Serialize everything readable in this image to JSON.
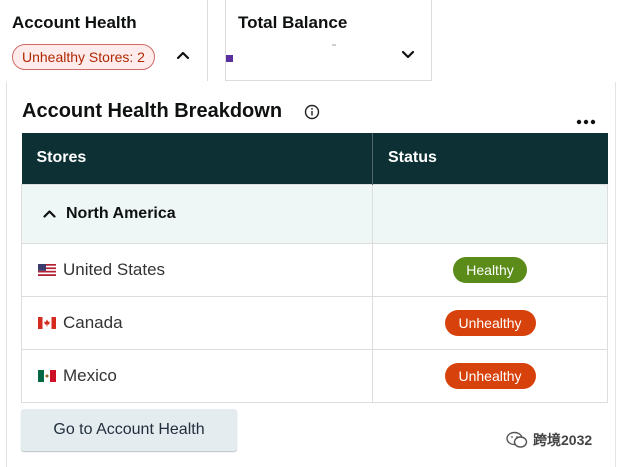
{
  "account_health_card": {
    "title": "Account Health",
    "pill_label": "Unhealthy Stores: 2",
    "chevron_icon": "chevron-up-icon"
  },
  "balance_card": {
    "title": "Total Balance",
    "chevron_icon": "chevron-down-icon"
  },
  "breakdown": {
    "title": "Account Health Breakdown",
    "info_icon": "info-icon",
    "more_icon": "more-options-icon",
    "columns": [
      "Stores",
      "Status"
    ],
    "region": {
      "name": "North America",
      "icon": "chevron-up-icon"
    },
    "rows": [
      {
        "country": "United States",
        "flag": "us-flag-icon",
        "status": "Healthy"
      },
      {
        "country": "Canada",
        "flag": "canada-flag-icon",
        "status": "Unhealthy"
      },
      {
        "country": "Mexico",
        "flag": "mexico-flag-icon",
        "status": "Unhealthy"
      }
    ]
  },
  "actions": {
    "go_label": "Go to Account Health"
  },
  "watermark": {
    "text": "跨境2032"
  },
  "colors": {
    "header_bg": "#0c3033",
    "healthy": "#5b8c1a",
    "unhealthy": "#d7410b",
    "pill_border": "#d06a66",
    "region_bg": "#eef6f6",
    "button_bg": "#e4ecef"
  }
}
